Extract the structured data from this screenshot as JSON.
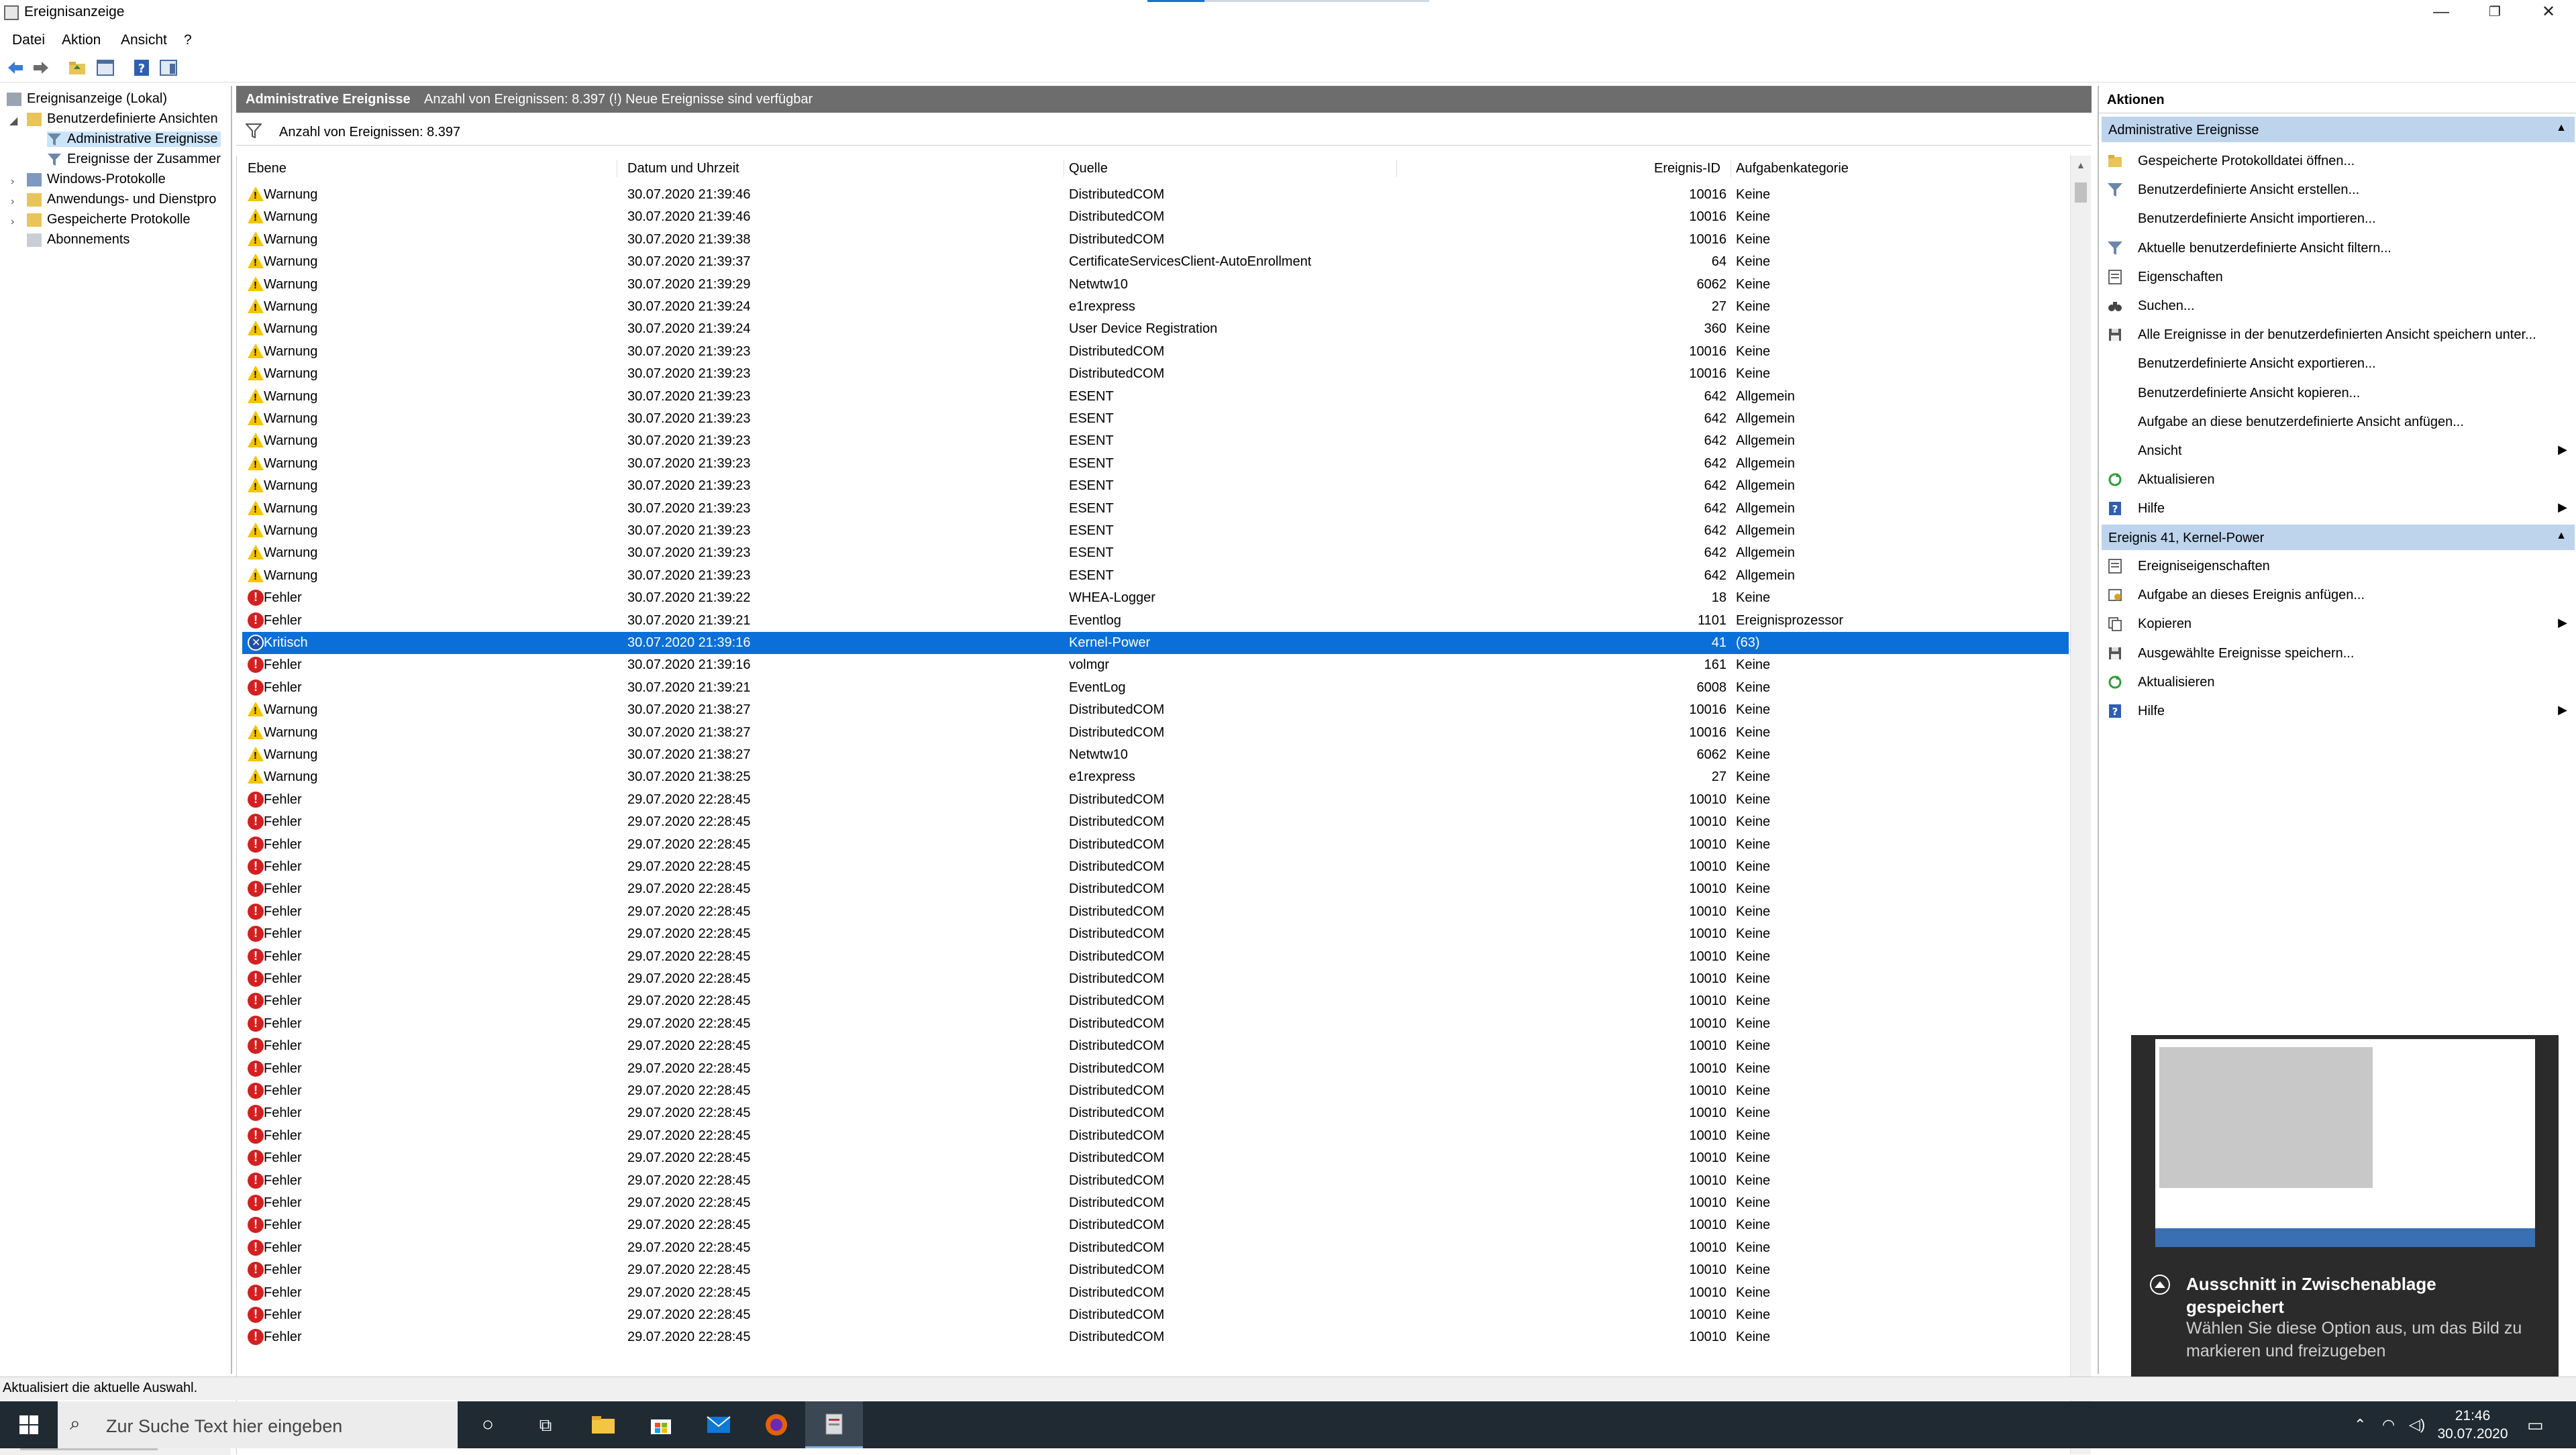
{
  "window": {
    "title": "Ereignisanzeige",
    "controls": {
      "minimize": "—",
      "restore": "❐",
      "close": "✕"
    }
  },
  "menu": [
    "Datei",
    "Aktion",
    "Ansicht",
    "?"
  ],
  "tree": {
    "items": [
      {
        "label": "Ereignisanzeige (Lokal)"
      },
      {
        "label": "Benutzerdefinierte Ansichten"
      },
      {
        "label": "Administrative Ereignisse"
      },
      {
        "label": "Ereignisse der Zusammer"
      },
      {
        "label": "Windows-Protokolle"
      },
      {
        "label": "Anwendungs- und Dienstpro"
      },
      {
        "label": "Gespeicherte Protokolle"
      },
      {
        "label": "Abonnements"
      }
    ]
  },
  "center": {
    "header_title": "Administrative Ereignisse",
    "header_info": "Anzahl von Ereignissen: 8.397 (!) Neue Ereignisse sind verfügbar",
    "filter_text": "Anzahl von Ereignissen: 8.397",
    "columns": [
      "Ebene",
      "Datum und Uhrzeit",
      "Quelle",
      "Ereignis-ID",
      "Aufgabenkategorie"
    ],
    "rows": [
      {
        "level": "Warnung",
        "type": "warn",
        "date": "30.07.2020 21:39:46",
        "source": "DistributedCOM",
        "id": "10016",
        "cat": "Keine"
      },
      {
        "level": "Warnung",
        "type": "warn",
        "date": "30.07.2020 21:39:46",
        "source": "DistributedCOM",
        "id": "10016",
        "cat": "Keine"
      },
      {
        "level": "Warnung",
        "type": "warn",
        "date": "30.07.2020 21:39:38",
        "source": "DistributedCOM",
        "id": "10016",
        "cat": "Keine"
      },
      {
        "level": "Warnung",
        "type": "warn",
        "date": "30.07.2020 21:39:37",
        "source": "CertificateServicesClient-AutoEnrollment",
        "id": "64",
        "cat": "Keine"
      },
      {
        "level": "Warnung",
        "type": "warn",
        "date": "30.07.2020 21:39:29",
        "source": "Netwtw10",
        "id": "6062",
        "cat": "Keine"
      },
      {
        "level": "Warnung",
        "type": "warn",
        "date": "30.07.2020 21:39:24",
        "source": "e1rexpress",
        "id": "27",
        "cat": "Keine"
      },
      {
        "level": "Warnung",
        "type": "warn",
        "date": "30.07.2020 21:39:24",
        "source": "User Device Registration",
        "id": "360",
        "cat": "Keine"
      },
      {
        "level": "Warnung",
        "type": "warn",
        "date": "30.07.2020 21:39:23",
        "source": "DistributedCOM",
        "id": "10016",
        "cat": "Keine"
      },
      {
        "level": "Warnung",
        "type": "warn",
        "date": "30.07.2020 21:39:23",
        "source": "DistributedCOM",
        "id": "10016",
        "cat": "Keine"
      },
      {
        "level": "Warnung",
        "type": "warn",
        "date": "30.07.2020 21:39:23",
        "source": "ESENT",
        "id": "642",
        "cat": "Allgemein"
      },
      {
        "level": "Warnung",
        "type": "warn",
        "date": "30.07.2020 21:39:23",
        "source": "ESENT",
        "id": "642",
        "cat": "Allgemein"
      },
      {
        "level": "Warnung",
        "type": "warn",
        "date": "30.07.2020 21:39:23",
        "source": "ESENT",
        "id": "642",
        "cat": "Allgemein"
      },
      {
        "level": "Warnung",
        "type": "warn",
        "date": "30.07.2020 21:39:23",
        "source": "ESENT",
        "id": "642",
        "cat": "Allgemein"
      },
      {
        "level": "Warnung",
        "type": "warn",
        "date": "30.07.2020 21:39:23",
        "source": "ESENT",
        "id": "642",
        "cat": "Allgemein"
      },
      {
        "level": "Warnung",
        "type": "warn",
        "date": "30.07.2020 21:39:23",
        "source": "ESENT",
        "id": "642",
        "cat": "Allgemein"
      },
      {
        "level": "Warnung",
        "type": "warn",
        "date": "30.07.2020 21:39:23",
        "source": "ESENT",
        "id": "642",
        "cat": "Allgemein"
      },
      {
        "level": "Warnung",
        "type": "warn",
        "date": "30.07.2020 21:39:23",
        "source": "ESENT",
        "id": "642",
        "cat": "Allgemein"
      },
      {
        "level": "Warnung",
        "type": "warn",
        "date": "30.07.2020 21:39:23",
        "source": "ESENT",
        "id": "642",
        "cat": "Allgemein"
      },
      {
        "level": "Fehler",
        "type": "err",
        "date": "30.07.2020 21:39:22",
        "source": "WHEA-Logger",
        "id": "18",
        "cat": "Keine"
      },
      {
        "level": "Fehler",
        "type": "err",
        "date": "30.07.2020 21:39:21",
        "source": "Eventlog",
        "id": "1101",
        "cat": "Ereignisprozessor"
      },
      {
        "level": "Kritisch",
        "type": "crit",
        "selected": true,
        "date": "30.07.2020 21:39:16",
        "source": "Kernel-Power",
        "id": "41",
        "cat": "(63)"
      },
      {
        "level": "Fehler",
        "type": "err",
        "date": "30.07.2020 21:39:16",
        "source": "volmgr",
        "id": "161",
        "cat": "Keine"
      },
      {
        "level": "Fehler",
        "type": "err",
        "date": "30.07.2020 21:39:21",
        "source": "EventLog",
        "id": "6008",
        "cat": "Keine"
      },
      {
        "level": "Warnung",
        "type": "warn",
        "date": "30.07.2020 21:38:27",
        "source": "DistributedCOM",
        "id": "10016",
        "cat": "Keine"
      },
      {
        "level": "Warnung",
        "type": "warn",
        "date": "30.07.2020 21:38:27",
        "source": "DistributedCOM",
        "id": "10016",
        "cat": "Keine"
      },
      {
        "level": "Warnung",
        "type": "warn",
        "date": "30.07.2020 21:38:27",
        "source": "Netwtw10",
        "id": "6062",
        "cat": "Keine"
      },
      {
        "level": "Warnung",
        "type": "warn",
        "date": "30.07.2020 21:38:25",
        "source": "e1rexpress",
        "id": "27",
        "cat": "Keine"
      },
      {
        "level": "Fehler",
        "type": "err",
        "date": "29.07.2020 22:28:45",
        "source": "DistributedCOM",
        "id": "10010",
        "cat": "Keine"
      },
      {
        "level": "Fehler",
        "type": "err",
        "date": "29.07.2020 22:28:45",
        "source": "DistributedCOM",
        "id": "10010",
        "cat": "Keine"
      },
      {
        "level": "Fehler",
        "type": "err",
        "date": "29.07.2020 22:28:45",
        "source": "DistributedCOM",
        "id": "10010",
        "cat": "Keine"
      },
      {
        "level": "Fehler",
        "type": "err",
        "date": "29.07.2020 22:28:45",
        "source": "DistributedCOM",
        "id": "10010",
        "cat": "Keine"
      },
      {
        "level": "Fehler",
        "type": "err",
        "date": "29.07.2020 22:28:45",
        "source": "DistributedCOM",
        "id": "10010",
        "cat": "Keine"
      },
      {
        "level": "Fehler",
        "type": "err",
        "date": "29.07.2020 22:28:45",
        "source": "DistributedCOM",
        "id": "10010",
        "cat": "Keine"
      },
      {
        "level": "Fehler",
        "type": "err",
        "date": "29.07.2020 22:28:45",
        "source": "DistributedCOM",
        "id": "10010",
        "cat": "Keine"
      },
      {
        "level": "Fehler",
        "type": "err",
        "date": "29.07.2020 22:28:45",
        "source": "DistributedCOM",
        "id": "10010",
        "cat": "Keine"
      },
      {
        "level": "Fehler",
        "type": "err",
        "date": "29.07.2020 22:28:45",
        "source": "DistributedCOM",
        "id": "10010",
        "cat": "Keine"
      },
      {
        "level": "Fehler",
        "type": "err",
        "date": "29.07.2020 22:28:45",
        "source": "DistributedCOM",
        "id": "10010",
        "cat": "Keine"
      },
      {
        "level": "Fehler",
        "type": "err",
        "date": "29.07.2020 22:28:45",
        "source": "DistributedCOM",
        "id": "10010",
        "cat": "Keine"
      },
      {
        "level": "Fehler",
        "type": "err",
        "date": "29.07.2020 22:28:45",
        "source": "DistributedCOM",
        "id": "10010",
        "cat": "Keine"
      },
      {
        "level": "Fehler",
        "type": "err",
        "date": "29.07.2020 22:28:45",
        "source": "DistributedCOM",
        "id": "10010",
        "cat": "Keine"
      },
      {
        "level": "Fehler",
        "type": "err",
        "date": "29.07.2020 22:28:45",
        "source": "DistributedCOM",
        "id": "10010",
        "cat": "Keine"
      },
      {
        "level": "Fehler",
        "type": "err",
        "date": "29.07.2020 22:28:45",
        "source": "DistributedCOM",
        "id": "10010",
        "cat": "Keine"
      },
      {
        "level": "Fehler",
        "type": "err",
        "date": "29.07.2020 22:28:45",
        "source": "DistributedCOM",
        "id": "10010",
        "cat": "Keine"
      },
      {
        "level": "Fehler",
        "type": "err",
        "date": "29.07.2020 22:28:45",
        "source": "DistributedCOM",
        "id": "10010",
        "cat": "Keine"
      },
      {
        "level": "Fehler",
        "type": "err",
        "date": "29.07.2020 22:28:45",
        "source": "DistributedCOM",
        "id": "10010",
        "cat": "Keine"
      },
      {
        "level": "Fehler",
        "type": "err",
        "date": "29.07.2020 22:28:45",
        "source": "DistributedCOM",
        "id": "10010",
        "cat": "Keine"
      },
      {
        "level": "Fehler",
        "type": "err",
        "date": "29.07.2020 22:28:45",
        "source": "DistributedCOM",
        "id": "10010",
        "cat": "Keine"
      },
      {
        "level": "Fehler",
        "type": "err",
        "date": "29.07.2020 22:28:45",
        "source": "DistributedCOM",
        "id": "10010",
        "cat": "Keine"
      },
      {
        "level": "Fehler",
        "type": "err",
        "date": "29.07.2020 22:28:45",
        "source": "DistributedCOM",
        "id": "10010",
        "cat": "Keine"
      },
      {
        "level": "Fehler",
        "type": "err",
        "date": "29.07.2020 22:28:45",
        "source": "DistributedCOM",
        "id": "10010",
        "cat": "Keine"
      },
      {
        "level": "Fehler",
        "type": "err",
        "date": "29.07.2020 22:28:45",
        "source": "DistributedCOM",
        "id": "10010",
        "cat": "Keine"
      },
      {
        "level": "Fehler",
        "type": "err",
        "date": "29.07.2020 22:28:45",
        "source": "DistributedCOM",
        "id": "10010",
        "cat": "Keine"
      }
    ]
  },
  "actions": {
    "title": "Aktionen",
    "section1": {
      "title": "Administrative Ereignisse",
      "items": [
        {
          "label": "Gespeicherte Protokolldatei öffnen...",
          "icon": "folder-open-icon"
        },
        {
          "label": "Benutzerdefinierte Ansicht erstellen...",
          "icon": "filter-icon"
        },
        {
          "label": "Benutzerdefinierte Ansicht importieren...",
          "icon": ""
        },
        {
          "label": "Aktuelle benutzerdefinierte Ansicht filtern...",
          "icon": "filter-icon"
        },
        {
          "label": "Eigenschaften",
          "icon": "properties-icon"
        },
        {
          "label": "Suchen...",
          "icon": "binoculars-icon"
        },
        {
          "label": "Alle Ereignisse in der benutzerdefinierten Ansicht speichern unter...",
          "icon": "save-icon"
        },
        {
          "label": "Benutzerdefinierte Ansicht exportieren...",
          "icon": ""
        },
        {
          "label": "Benutzerdefinierte Ansicht kopieren...",
          "icon": ""
        },
        {
          "label": "Aufgabe an diese benutzerdefinierte Ansicht anfügen...",
          "icon": ""
        },
        {
          "label": "Ansicht",
          "icon": "",
          "submenu": true
        },
        {
          "label": "Aktualisieren",
          "icon": "refresh-icon"
        },
        {
          "label": "Hilfe",
          "icon": "help-icon",
          "submenu": true
        }
      ]
    },
    "section2": {
      "title": "Ereignis 41, Kernel-Power",
      "items": [
        {
          "label": "Ereigniseigenschaften",
          "icon": "properties-icon"
        },
        {
          "label": "Aufgabe an dieses Ereignis anfügen...",
          "icon": "task-icon"
        },
        {
          "label": "Kopieren",
          "icon": "copy-icon",
          "submenu": true
        },
        {
          "label": "Ausgewählte Ereignisse speichern...",
          "icon": "save-icon"
        },
        {
          "label": "Aktualisieren",
          "icon": "refresh-icon"
        },
        {
          "label": "Hilfe",
          "icon": "help-icon",
          "submenu": true
        }
      ]
    }
  },
  "notification": {
    "title": "Ausschnitt in Zwischenablage gespeichert",
    "body": "Wählen Sie diese Option aus, um das Bild zu markieren und freizugeben"
  },
  "status": {
    "text": "Aktualisiert die aktuelle Auswahl."
  },
  "taskbar": {
    "search_placeholder": "Zur Suche Text hier eingeben",
    "time": "21:46",
    "date": "30.07.2020"
  }
}
